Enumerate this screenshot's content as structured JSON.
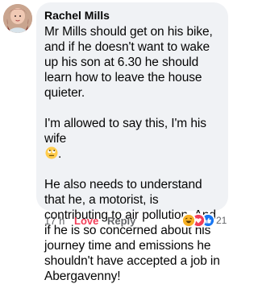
{
  "comment": {
    "author": "Rachel Mills",
    "paragraphs": [
      "Mr Mills should get on his bike, and if he doesn't want to wake up his son at 6.30 he should learn how to leave the house quieter.",
      "I'm allowed to say this, I'm his wife",
      "He also needs to understand that he, a motorist, is contributing to air pollution. And if he is so concerned about his journey time and emissions he shouldn't have accepted a job in Abergavenny!"
    ],
    "inline_emoji": "rolling-eyes-emoji",
    "trailing_punct": "."
  },
  "footer": {
    "time": "17 h",
    "love_label": "Love",
    "reply_label": "Reply"
  },
  "reactions": {
    "icons": [
      "haha-reaction-icon",
      "love-reaction-icon",
      "like-reaction-icon"
    ],
    "count": "21"
  },
  "colors": {
    "bubble": "#f0f2f5",
    "text": "#050505",
    "muted": "#65676b",
    "love": "#f33e58",
    "like": "#1877f2",
    "haha": "#f7b125"
  }
}
